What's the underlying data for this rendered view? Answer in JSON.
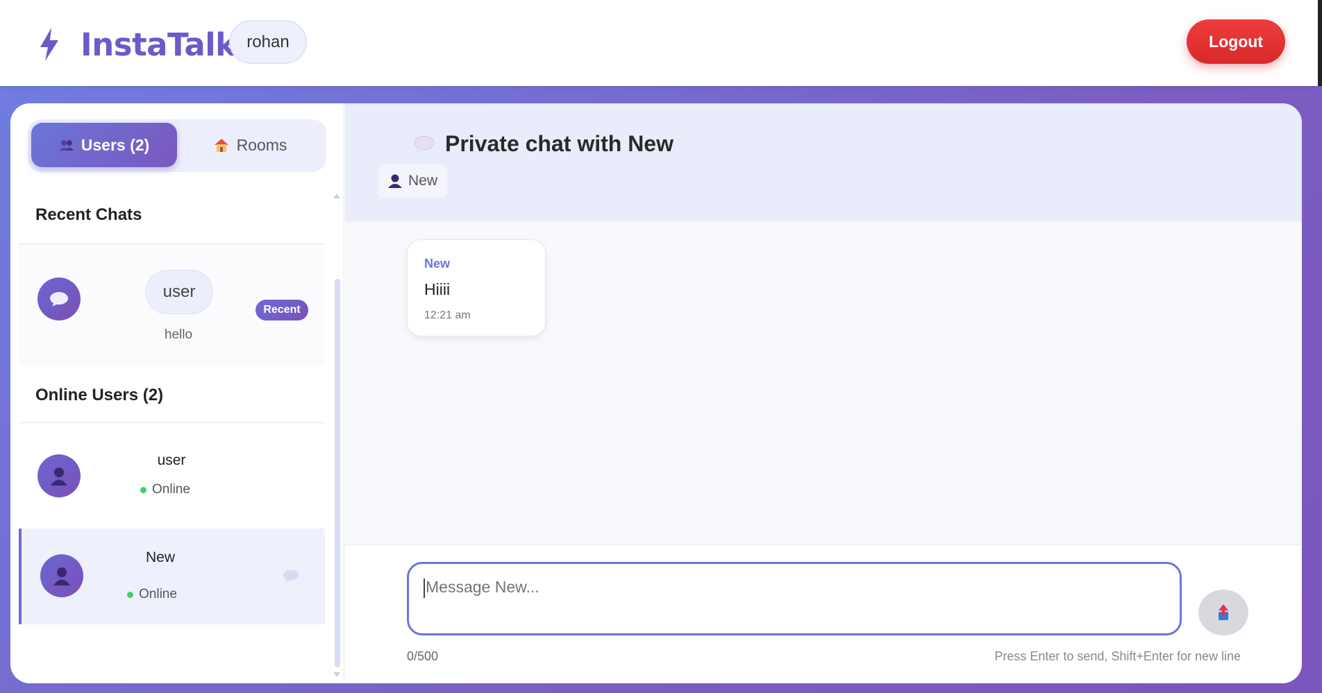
{
  "header": {
    "brand": "InstaTalk",
    "logo_icon": "lightning-icon",
    "current_user": "rohan",
    "logout_label": "Logout",
    "accent": "#6a5bc8",
    "logout_color": "#e53535"
  },
  "sidebar": {
    "tabs": [
      {
        "icon": "users-icon",
        "label": "Users (2)",
        "active": true
      },
      {
        "icon": "house-icon",
        "label": "Rooms",
        "active": false
      }
    ],
    "recent_title": "Recent Chats",
    "recent": [
      {
        "name": "user",
        "last_message": "hello",
        "badge": "Recent",
        "icon": "speech-bubble-icon"
      }
    ],
    "online_title": "Online Users (2)",
    "users": [
      {
        "name": "user",
        "status": "Online",
        "selected": false
      },
      {
        "name": "New",
        "status": "Online",
        "selected": true
      }
    ]
  },
  "chat": {
    "title": "Private chat with New",
    "title_icon": "speech-bubble-icon",
    "participant": "New",
    "messages": [
      {
        "sender": "New",
        "text": "Hiiii",
        "time": "12:21 am"
      }
    ],
    "input_placeholder": "Message New...",
    "counter": "0/500",
    "hint": "Press Enter to send, Shift+Enter for new line",
    "send_icon": "send-icon"
  }
}
